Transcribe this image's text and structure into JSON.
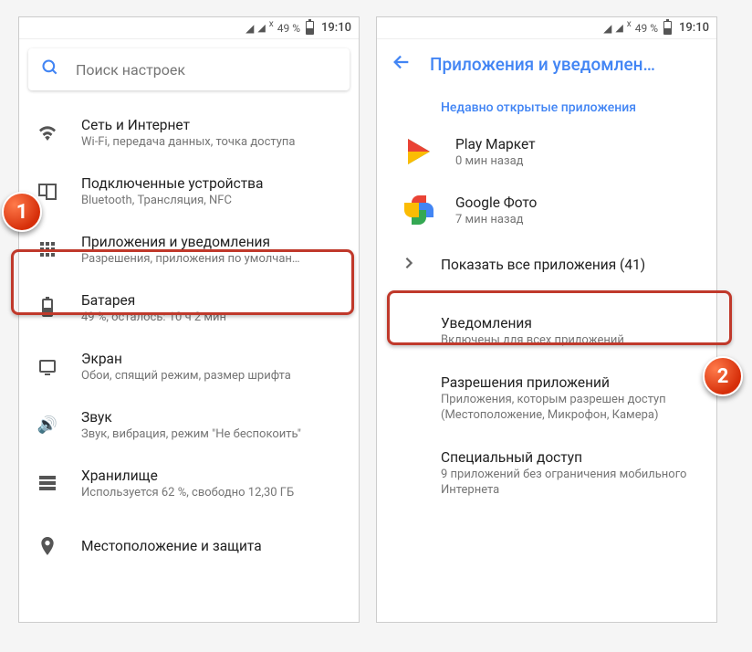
{
  "status": {
    "batteryPct": "49 %",
    "clock": "19:10"
  },
  "search": {
    "placeholder": "Поиск настроек"
  },
  "settings": {
    "items": [
      {
        "title": "Сеть и Интернет",
        "sub": "Wi-Fi, передача данных, точка доступа"
      },
      {
        "title": "Подключенные устройства",
        "sub": "Bluetooth, Трансляция, NFC"
      },
      {
        "title": "Приложения и уведомления",
        "sub": "Разрешения, приложения по умолчан…"
      },
      {
        "title": "Батарея",
        "sub": "49 %, осталось: 10 ч 2 мин"
      },
      {
        "title": "Экран",
        "sub": "Обои, спящий режим, размер шрифта"
      },
      {
        "title": "Звук",
        "sub": "Звук, вибрация, режим \"Не беспокоить\""
      },
      {
        "title": "Хранилище",
        "sub": "Используется 62 %, свободно 12,30 ГБ"
      },
      {
        "title": "Местоположение и защита",
        "sub": ""
      }
    ]
  },
  "apps": {
    "header_title": "Приложения и уведомлен…",
    "recent_header": "Недавно открытые приложения",
    "recent": [
      {
        "title": "Play Маркет",
        "sub": "0 мин назад"
      },
      {
        "title": "Google Фото",
        "sub": "7 мин назад"
      }
    ],
    "show_all": "Показать все приложения (41)",
    "details": [
      {
        "title": "Уведомления",
        "sub": "Включены для всех приложений"
      },
      {
        "title": "Разрешения приложений",
        "sub": "Приложения, которым разрешен доступ (Местоположение, Микрофон, Камера)"
      },
      {
        "title": "Специальный доступ",
        "sub": "9 приложений без ограничения мобильного Интернета"
      }
    ]
  },
  "markers": {
    "one": "1",
    "two": "2"
  }
}
